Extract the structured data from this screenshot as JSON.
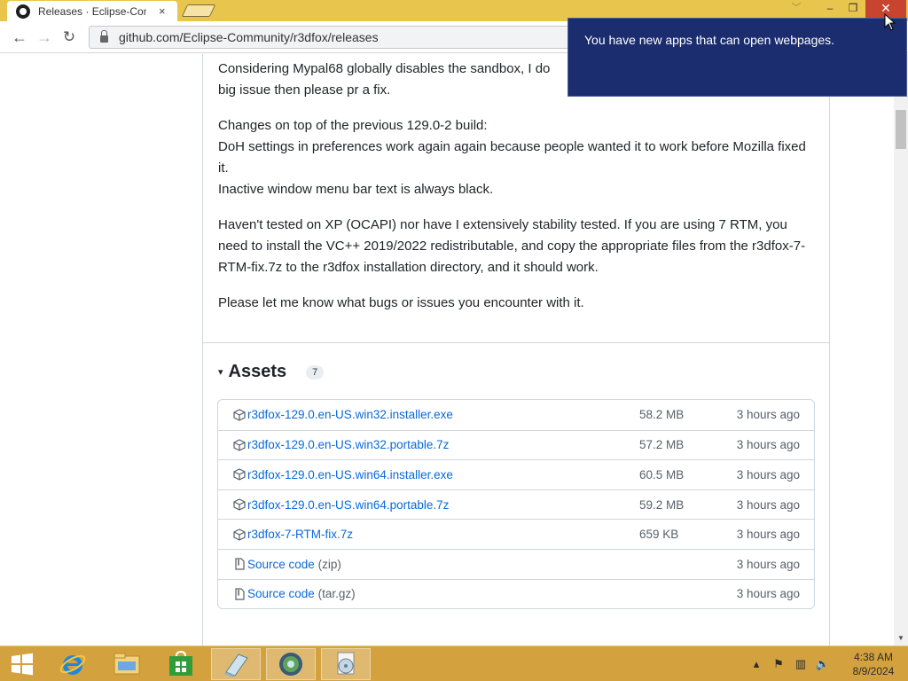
{
  "browser": {
    "tab_title": "Releases · Eclipse-Community",
    "tab_close": "×",
    "url": "github.com/Eclipse-Community/r3dfox/releases",
    "window_controls": {
      "minimize": "–",
      "maximize": "❐",
      "close": "✕",
      "chevron": "﹀"
    },
    "nav": {
      "back": "←",
      "forward": "→",
      "reload": "↻"
    }
  },
  "notification": {
    "text": "You have new apps that can open webpages."
  },
  "release": {
    "paragraph_1": "Considering Mypal68 globally disables the sandbox, I do\nbig issue then please pr a fix.",
    "paragraph_2": "Changes on top of the previous 129.0-2 build:\nDoH settings in preferences work again again because people wanted it to work before Mozilla fixed it.\nInactive window menu bar text is always black.",
    "paragraph_3": "Haven't tested on XP (OCAPI) nor have I extensively stability tested. If you are using 7 RTM, you need to install the VC++ 2019/2022 redistributable, and copy the appropriate files from the r3dfox-7-RTM-fix.7z to the r3dfox installation directory, and it should work.",
    "paragraph_4": "Please let me know what bugs or issues you encounter with it."
  },
  "assets": {
    "caret": "▾",
    "title": "Assets",
    "count": "7",
    "items": [
      {
        "name": "r3dfox-129.0.en-US.win32.installer.exe",
        "suffix": "",
        "size": "58.2 MB",
        "time": "3 hours ago",
        "icon": "package-icon"
      },
      {
        "name": "r3dfox-129.0.en-US.win32.portable.7z",
        "suffix": "",
        "size": "57.2 MB",
        "time": "3 hours ago",
        "icon": "package-icon"
      },
      {
        "name": "r3dfox-129.0.en-US.win64.installer.exe",
        "suffix": "",
        "size": "60.5 MB",
        "time": "3 hours ago",
        "icon": "package-icon"
      },
      {
        "name": "r3dfox-129.0.en-US.win64.portable.7z",
        "suffix": "",
        "size": "59.2 MB",
        "time": "3 hours ago",
        "icon": "package-icon"
      },
      {
        "name": "r3dfox-7-RTM-fix.7z",
        "suffix": "",
        "size": "659 KB",
        "time": "3 hours ago",
        "icon": "package-icon"
      },
      {
        "name": "Source code",
        "suffix": "(zip)",
        "size": "",
        "time": "3 hours ago",
        "icon": "file-zip-icon"
      },
      {
        "name": "Source code",
        "suffix": "(tar.gz)",
        "size": "",
        "time": "3 hours ago",
        "icon": "file-zip-icon"
      }
    ]
  },
  "taskbar": {
    "apps": [
      "windows-start-icon",
      "internet-explorer-icon",
      "file-explorer-icon",
      "store-icon",
      "notepad-icon",
      "browser-icon",
      "media-player-icon"
    ],
    "clock_time": "4:38 AM",
    "clock_date": "8/9/2024"
  },
  "colors": {
    "link": "#0969da",
    "titlebar": "#e8c54d",
    "taskbar": "#d3a23f",
    "toast": "#1b2d6e",
    "close": "#c7442f"
  }
}
